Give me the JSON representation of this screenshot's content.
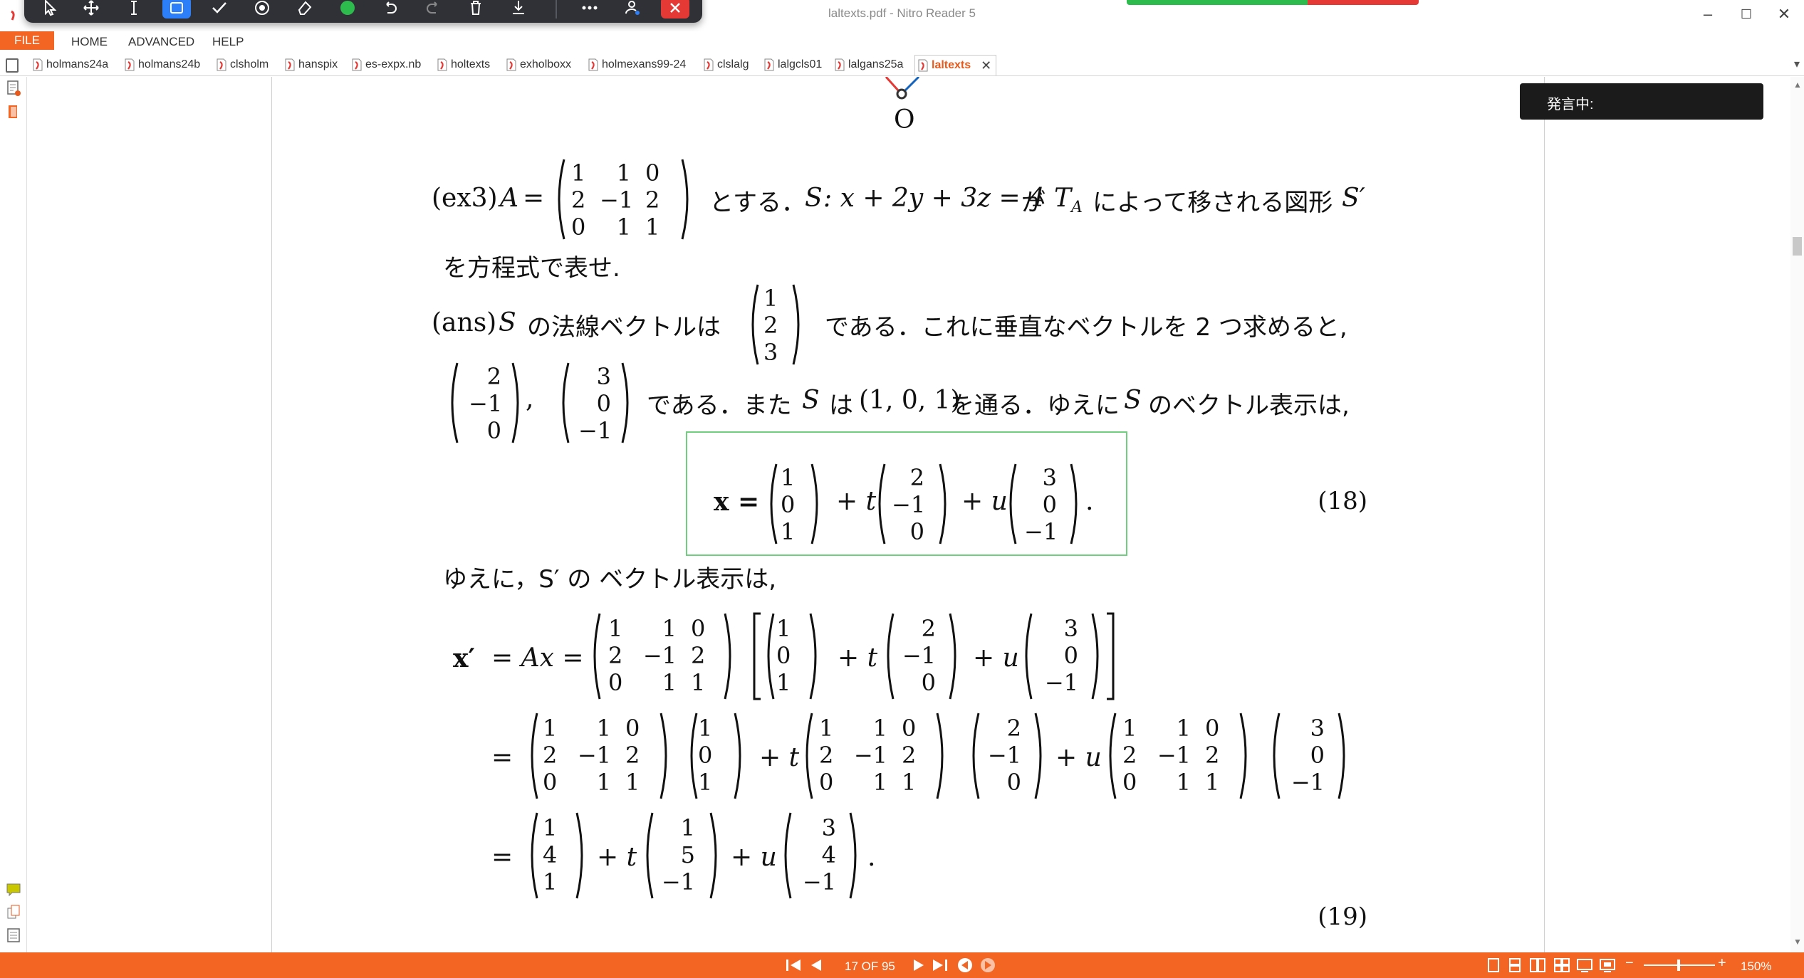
{
  "window": {
    "title": "laltexts.pdf - Nitro Reader 5",
    "minimize_glyph": "–",
    "maximize_glyph": "☐",
    "close_glyph": "✕"
  },
  "menu": {
    "file": "FILE",
    "home": "HOME",
    "advanced": "ADVANCED",
    "help": "HELP"
  },
  "tabs": [
    {
      "label": "holmans24a"
    },
    {
      "label": "holmans24b"
    },
    {
      "label": "clsholm"
    },
    {
      "label": "hanspix"
    },
    {
      "label": "es-expx.nb"
    },
    {
      "label": "holtexts"
    },
    {
      "label": "exholboxx"
    },
    {
      "label": "holmexans99-24"
    },
    {
      "label": "clslalg"
    },
    {
      "label": "lalgcls01"
    },
    {
      "label": "lalgans25a"
    },
    {
      "label": "laltexts",
      "active": true
    }
  ],
  "tab_close_glyph": "✕",
  "tab_dropdown_glyph": "▾",
  "speaker": {
    "label": "発言中:"
  },
  "document": {
    "figure_label": "O",
    "ex3": {
      "label": "(ex3)",
      "A": "A",
      "eq": "=",
      "matrix_A": [
        [
          "1",
          "1",
          "0"
        ],
        [
          "2",
          "−1",
          "2"
        ],
        [
          "0",
          "1",
          "1"
        ]
      ],
      "text1": "とする．",
      "S": "S",
      "plane": ": x + 2y + 3z = 4",
      "text2": "が",
      "TA": "T",
      "TA_sub": "A",
      "text3": "によって移される図形",
      "Sprime": "S′",
      "line2": "を方程式で表せ."
    },
    "ans": {
      "label": "(ans)",
      "S": "S",
      "text1": "の法線ベクトルは",
      "normal": [
        "1",
        "2",
        "3"
      ],
      "text2": "である．これに垂直なベクトルを 2 つ求めると,",
      "v1": [
        "2",
        "−1",
        "0"
      ],
      "comma": ",",
      "v2": [
        "3",
        "0",
        "−1"
      ],
      "text3": "である．また",
      "S2": "S",
      "text4": "は",
      "point": "(1, 0, 1)",
      "text5": "を通る．ゆえに",
      "S3": "S",
      "text6": "のベクトル表示は,"
    },
    "eq18": {
      "lhs": "x =",
      "p": [
        "1",
        "0",
        "1"
      ],
      "plus_t": "+ t",
      "d1": [
        "2",
        "−1",
        "0"
      ],
      "plus_u": "+ u",
      "d2": [
        "3",
        "0",
        "−1"
      ],
      "period": ".",
      "number": "(18)"
    },
    "line_yueni": "ゆえに，S′ の ベクトル表示は,",
    "eq19": {
      "lhs": "x′",
      "eq1": "= Ax =",
      "A": [
        [
          "1",
          "1",
          "0"
        ],
        [
          "2",
          "−1",
          "2"
        ],
        [
          "0",
          "1",
          "1"
        ]
      ],
      "p": [
        "1",
        "0",
        "1"
      ],
      "plus_t": "+ t",
      "d1": [
        "2",
        "−1",
        "0"
      ],
      "plus_u": "+ u",
      "d2": [
        "3",
        "0",
        "−1"
      ],
      "eq2": "=",
      "eq3": "=",
      "r1": [
        "1",
        "4",
        "1"
      ],
      "r2": [
        "1",
        "5",
        "−1"
      ],
      "r3": [
        "3",
        "4",
        "−1"
      ],
      "period": ".",
      "number": "(19)"
    }
  },
  "status": {
    "page_indicator": "17 OF 95",
    "zoom": "150%",
    "zoom_minus": "−",
    "zoom_plus": "+"
  }
}
